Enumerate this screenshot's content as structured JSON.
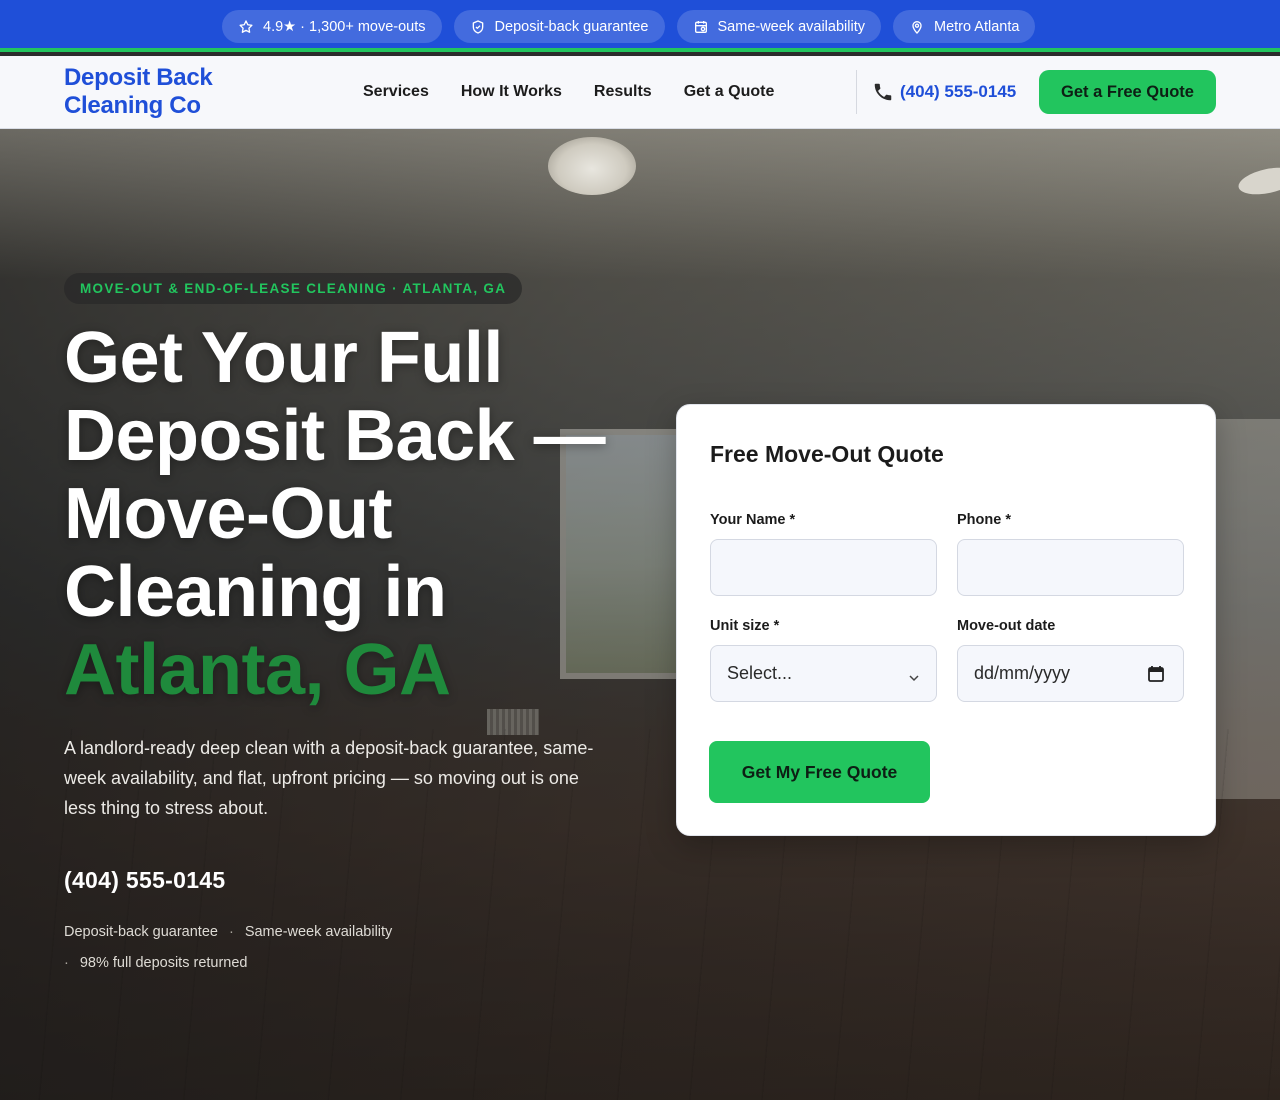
{
  "topbar": {
    "pills": [
      {
        "icon": "star-icon",
        "label": "4.9★ · 1,300+ move-outs"
      },
      {
        "icon": "shield-icon",
        "label": "Deposit-back guarantee"
      },
      {
        "icon": "calendar-icon",
        "label": "Same-week availability"
      },
      {
        "icon": "map-pin-icon",
        "label": "Metro Atlanta"
      }
    ]
  },
  "nav": {
    "logo_line1": "Deposit Back",
    "logo_line2": "Cleaning Co",
    "links": [
      "Services",
      "How It Works",
      "Results",
      "Get a Quote"
    ],
    "phone": "(404) 555-0145",
    "cta": "Get a Free Quote"
  },
  "hero": {
    "eyebrow": "MOVE-OUT & END-OF-LEASE CLEANING · ATLANTA, GA",
    "headline_main": "Get Your Full Deposit Back — Move-Out Cleaning in",
    "headline_accent": "Atlanta, GA",
    "subhead": "A landlord-ready deep clean with a deposit-back guarantee, same-week availability, and flat, upfront pricing — so moving out is one less thing to stress about.",
    "phone": "(404) 555-0145",
    "trust": [
      "Deposit-back guarantee",
      "Same-week availability",
      "98% full deposits returned"
    ]
  },
  "form": {
    "title": "Free Move-Out Quote",
    "name_label": "Your Name *",
    "name_value": "",
    "phone_label": "Phone *",
    "phone_value": "",
    "unit_label": "Unit size *",
    "unit_selected": "Select...",
    "date_label": "Move-out date",
    "date_placeholder": "dd/mm/yyyy",
    "submit": "Get My Free Quote"
  },
  "colors": {
    "brand_blue": "#1f4fd8",
    "accent_green": "#22c55e",
    "headline_green": "#1f8a3c"
  }
}
